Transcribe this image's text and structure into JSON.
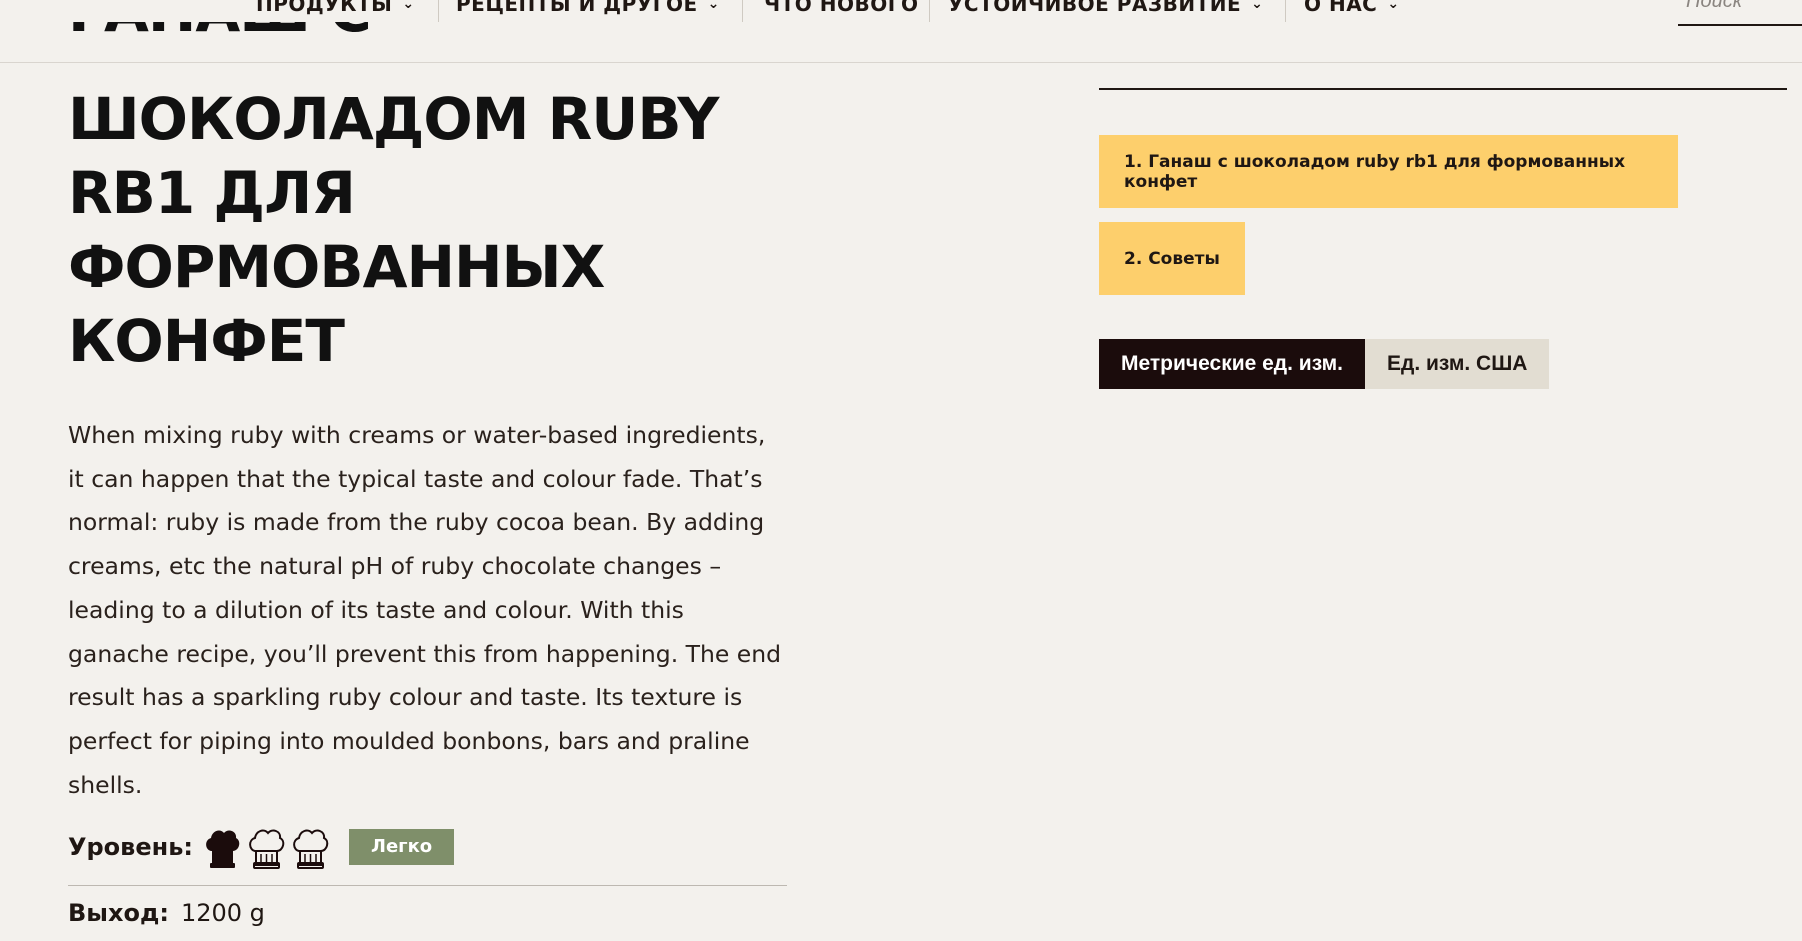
{
  "nav": {
    "items": [
      {
        "label": "ПРОДУКТЫ",
        "has_dropdown": true
      },
      {
        "label": "РЕЦЕПТЫ И ДРУГОЕ",
        "has_dropdown": true
      },
      {
        "label": "ЧТО НОВОГО",
        "has_dropdown": false
      },
      {
        "label": "УСТОЙЧИВОЕ РАЗВИТИЕ",
        "has_dropdown": true
      },
      {
        "label": "О НАС",
        "has_dropdown": true
      }
    ],
    "chevron": "⌄",
    "search_placeholder": "Поиск"
  },
  "recipe": {
    "title_hidden_line": "ГАНАШ С",
    "title": "ШОКОЛАДОМ RUBY RB1 ДЛЯ ФОРМОВАННЫХ КОНФЕТ",
    "description": "When mixing ruby with creams or water-based ingredients, it can happen that the typical taste and colour fade. That’s normal: ruby is made from the ruby cocoa bean. By adding creams, etc the natural pH of ruby chocolate changes – leading to a dilution of its taste and colour. With this ganache recipe, you’ll prevent this from happening. The end result has a sparkling ruby colour and taste. Its texture is perfect for piping into moulded bonbons, bars and praline shells.",
    "level_label": "Уровень:",
    "level_value": 1,
    "level_max": 3,
    "level_badge": "Легко",
    "yield_label": "Выход:",
    "yield_value": "1200 g"
  },
  "toc": {
    "items": [
      "1. Ганаш с шоколадом ruby rb1 для формованных конфет",
      "2. Советы"
    ]
  },
  "units": {
    "metric_label": "Метрические ед. изм.",
    "us_label": "Ед. изм. США",
    "selected": "metric"
  },
  "colors": {
    "background": "#f3f1ed",
    "toc_button": "#fdcf6c",
    "active_unit": "#1b0c0c",
    "inactive_unit": "#e2ddd2",
    "badge": "#7f8f6a",
    "text": "#1f1713"
  }
}
